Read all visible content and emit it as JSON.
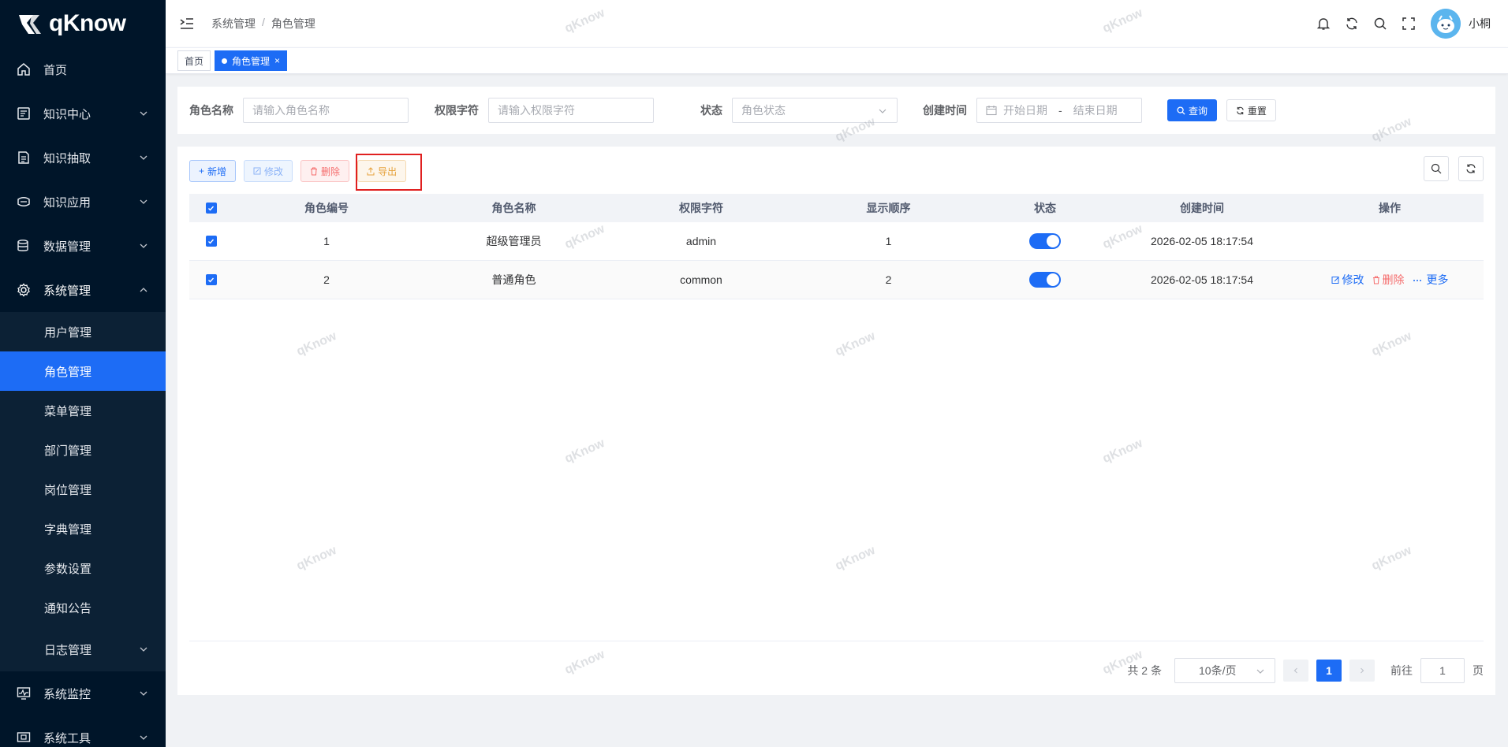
{
  "app": {
    "logo_text": "qKnow",
    "watermark": "qKnow"
  },
  "sidebar": {
    "items": [
      {
        "label": "首页",
        "icon": "home-icon",
        "has_children": false
      },
      {
        "label": "知识中心",
        "icon": "document-icon",
        "has_children": true
      },
      {
        "label": "知识抽取",
        "icon": "extract-icon",
        "has_children": true
      },
      {
        "label": "知识应用",
        "icon": "application-icon",
        "has_children": true
      },
      {
        "label": "数据管理",
        "icon": "database-icon",
        "has_children": true
      },
      {
        "label": "系统管理",
        "icon": "gear-icon",
        "has_children": true,
        "expanded": true
      }
    ],
    "system_sub": [
      {
        "label": "用户管理"
      },
      {
        "label": "角色管理",
        "active": true
      },
      {
        "label": "菜单管理"
      },
      {
        "label": "部门管理"
      },
      {
        "label": "岗位管理"
      },
      {
        "label": "字典管理"
      },
      {
        "label": "参数设置"
      },
      {
        "label": "通知公告"
      },
      {
        "label": "日志管理",
        "has_children": true
      }
    ],
    "bottom_items": [
      {
        "label": "系统监控",
        "icon": "monitor-icon"
      },
      {
        "label": "系统工具",
        "icon": "tools-icon"
      }
    ]
  },
  "header": {
    "breadcrumb": [
      "系统管理",
      "角色管理"
    ],
    "breadcrumb_sep": "/",
    "username": "小桐"
  },
  "tags": [
    {
      "label": "首页",
      "active": false
    },
    {
      "label": "角色管理",
      "active": true,
      "close": "×"
    }
  ],
  "search": {
    "role_name_label": "角色名称",
    "role_name_placeholder": "请输入角色名称",
    "perm_label": "权限字符",
    "perm_placeholder": "请输入权限字符",
    "status_label": "状态",
    "status_placeholder": "角色状态",
    "created_label": "创建时间",
    "start_placeholder": "开始日期",
    "range_sep": "-",
    "end_placeholder": "结束日期",
    "query_btn": "查询",
    "reset_btn": "重置"
  },
  "toolbar": {
    "add": "新增",
    "edit": "修改",
    "delete": "删除",
    "export": "导出"
  },
  "table": {
    "columns": [
      "角色编号",
      "角色名称",
      "权限字符",
      "显示顺序",
      "状态",
      "创建时间",
      "操作"
    ],
    "rows": [
      {
        "id": "1",
        "name": "超级管理员",
        "key": "admin",
        "sort": "1",
        "status": true,
        "created": "2026-02-05 18:17:54",
        "actions": []
      },
      {
        "id": "2",
        "name": "普通角色",
        "key": "common",
        "sort": "2",
        "status": true,
        "created": "2026-02-05 18:17:54",
        "actions": [
          "修改",
          "删除",
          "更多"
        ]
      }
    ]
  },
  "pagination": {
    "total_text": "共 2 条",
    "page_size": "10条/页",
    "current_page": "1",
    "goto_label": "前往",
    "goto_value": "1",
    "page_suffix": "页"
  },
  "colors": {
    "sidebar_bg": "#001529",
    "primary": "#1d6cf5",
    "danger": "#f56c6c",
    "warning": "#e6a23c"
  }
}
